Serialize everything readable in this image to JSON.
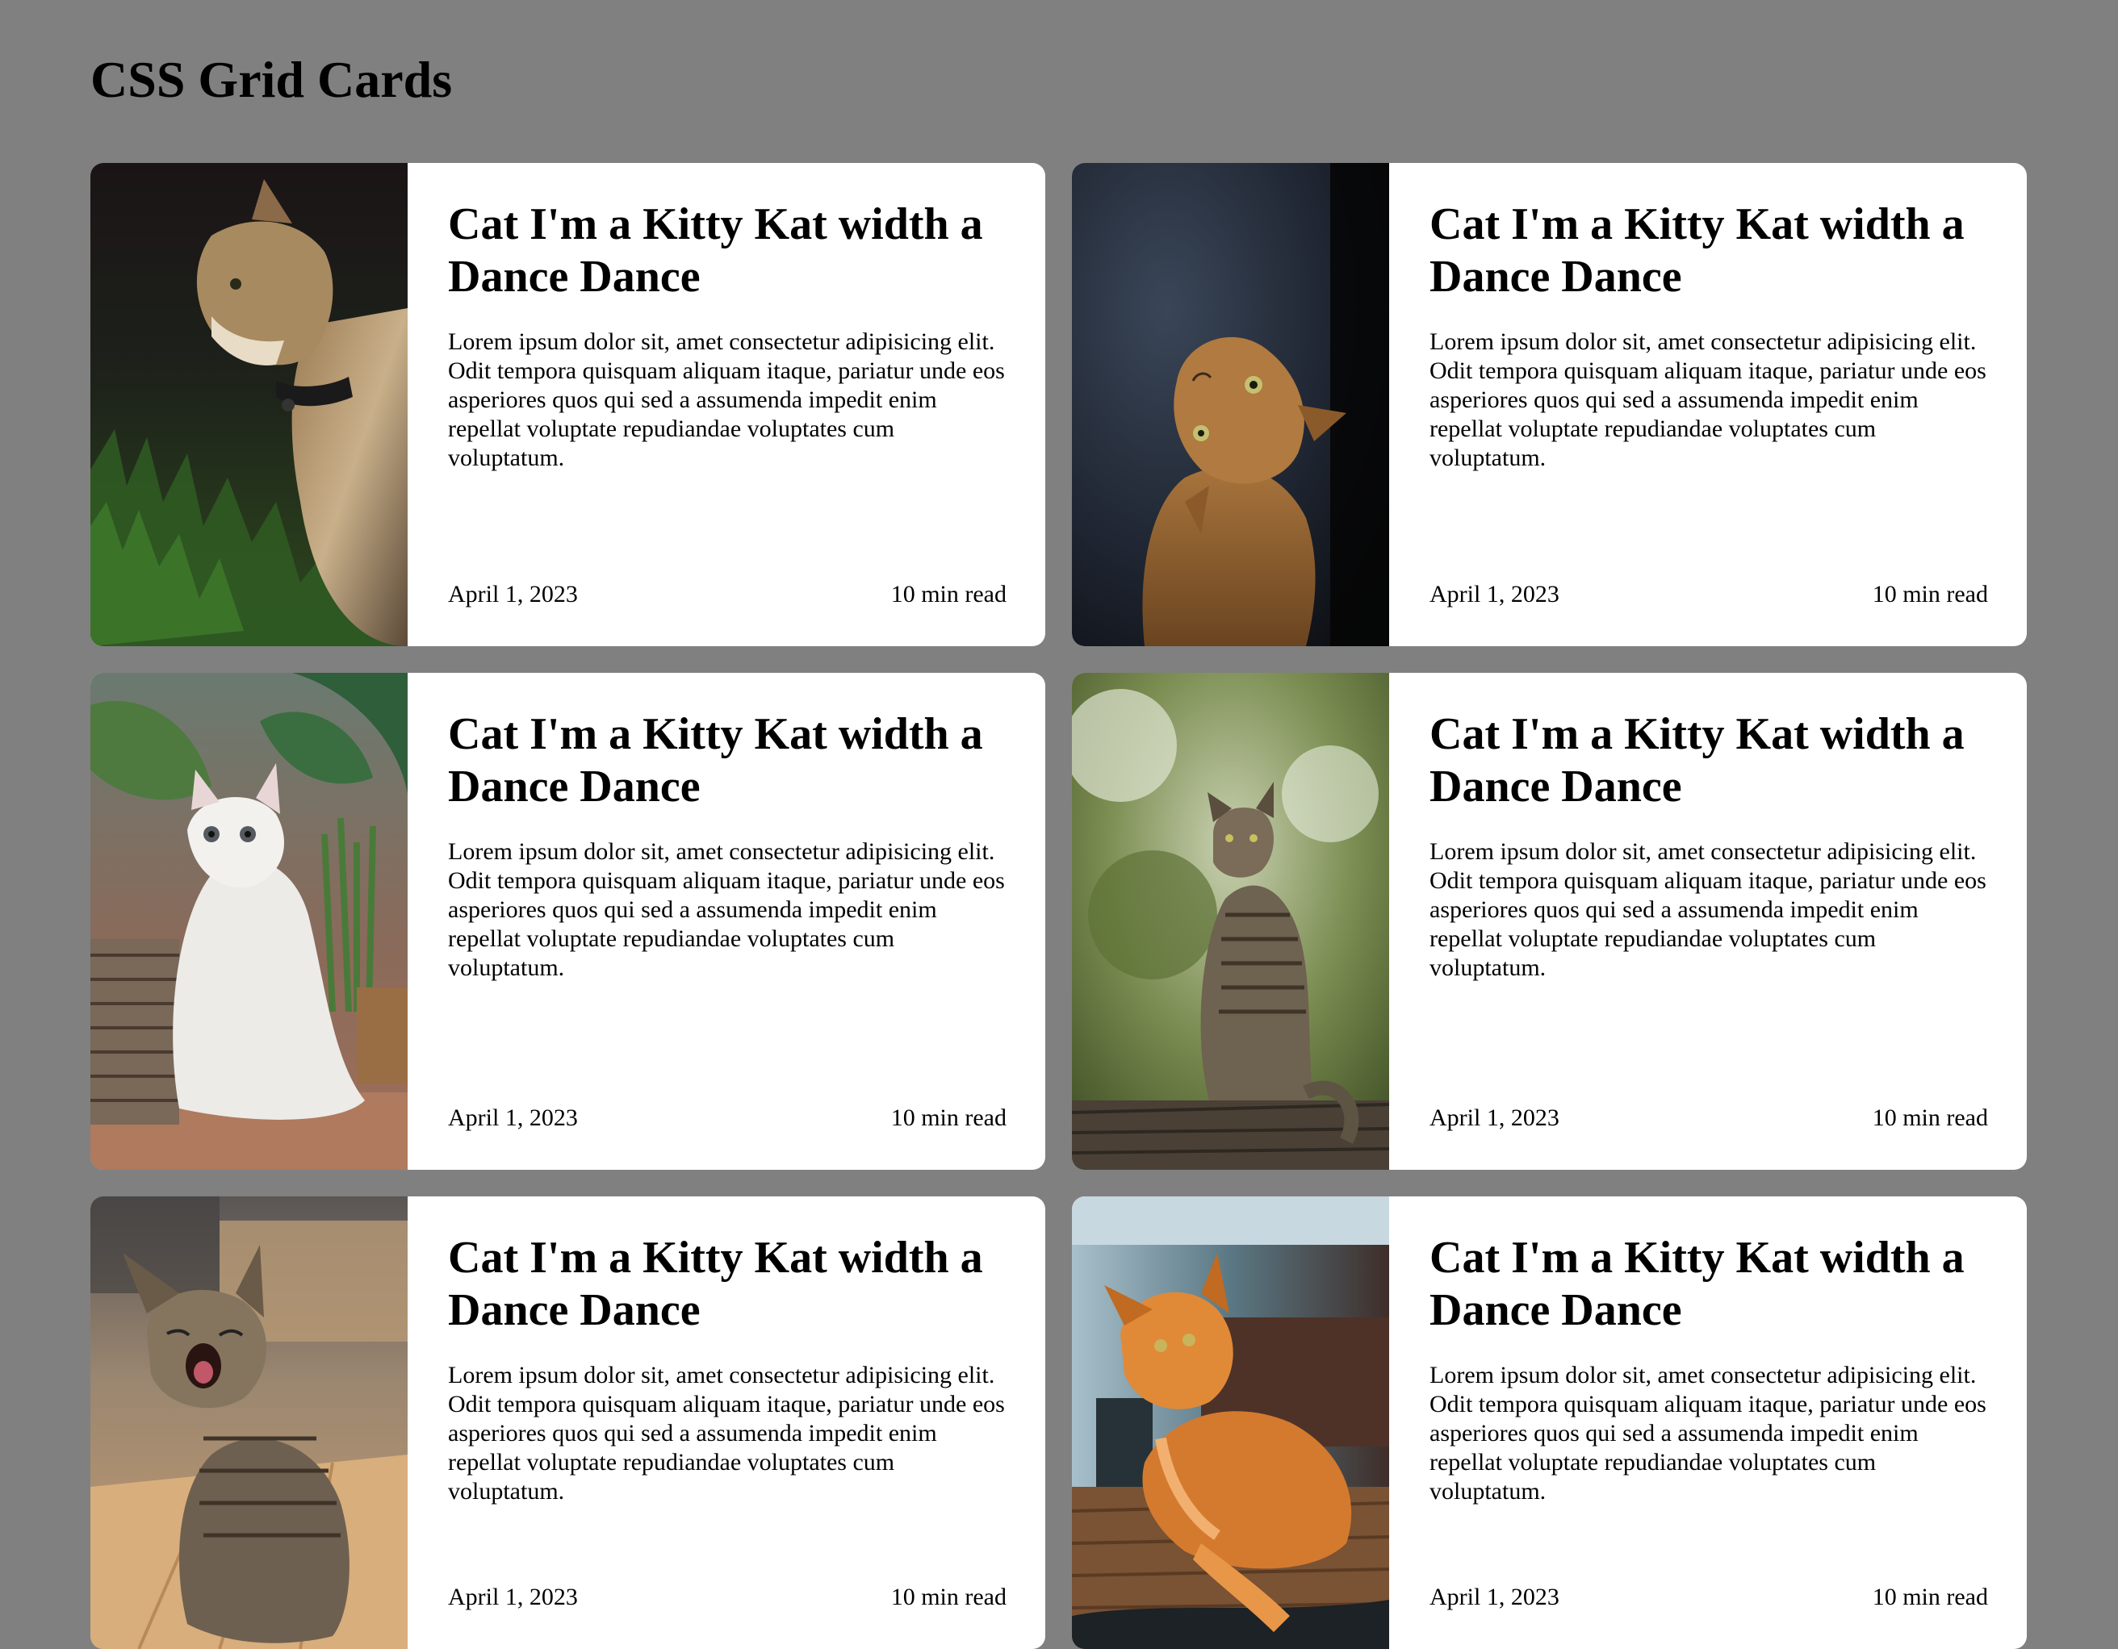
{
  "page": {
    "title": "CSS Grid Cards",
    "background": "#808080"
  },
  "cards": [
    {
      "image": "cat-photo-calico-grass",
      "title": "Cat I'm a Kitty Kat width a Dance Dance",
      "text": "Lorem ipsum dolor sit, amet consectetur adipisicing elit. Odit tempora quisquam aliquam itaque, pariatur unde eos asperiores quos qui sed a assumenda impedit enim repellat voluptate repudiandae voluptates cum voluptatum.",
      "date": "April 1, 2023",
      "read_time": "10 min read"
    },
    {
      "image": "cat-photo-orange-looking-up",
      "title": "Cat I'm a Kitty Kat width a Dance Dance",
      "text": "Lorem ipsum dolor sit, amet consectetur adipisicing elit. Odit tempora quisquam aliquam itaque, pariatur unde eos asperiores quos qui sed a assumenda impedit enim repellat voluptate repudiandae voluptates cum voluptatum.",
      "date": "April 1, 2023",
      "read_time": "10 min read"
    },
    {
      "image": "cat-photo-white-fluffy-plants",
      "title": "Cat I'm a Kitty Kat width a Dance Dance",
      "text": "Lorem ipsum dolor sit, amet consectetur adipisicing elit. Odit tempora quisquam aliquam itaque, pariatur unde eos asperiores quos qui sed a assumenda impedit enim repellat voluptate repudiandae voluptates cum voluptatum.",
      "date": "April 1, 2023",
      "read_time": "10 min read"
    },
    {
      "image": "cat-photo-tabby-on-fence",
      "title": "Cat I'm a Kitty Kat width a Dance Dance",
      "text": "Lorem ipsum dolor sit, amet consectetur adipisicing elit. Odit tempora quisquam aliquam itaque, pariatur unde eos asperiores quos qui sed a assumenda impedit enim repellat voluptate repudiandae voluptates cum voluptatum.",
      "date": "April 1, 2023",
      "read_time": "10 min read"
    },
    {
      "image": "cat-photo-kitten-yawning",
      "title": "Cat I'm a Kitty Kat width a Dance Dance",
      "text": "Lorem ipsum dolor sit, amet consectetur adipisicing elit. Odit tempora quisquam aliquam itaque, pariatur unde eos asperiores quos qui sed a assumenda impedit enim repellat voluptate repudiandae voluptates cum voluptatum.",
      "date": "April 1, 2023",
      "read_time": "10 min read"
    },
    {
      "image": "cat-photo-ginger-lying-table",
      "title": "Cat I'm a Kitty Kat width a Dance Dance",
      "text": "Lorem ipsum dolor sit, amet consectetur adipisicing elit. Odit tempora quisquam aliquam itaque, pariatur unde eos asperiores quos qui sed a assumenda impedit enim repellat voluptate repudiandae voluptates cum voluptatum.",
      "date": "April 1, 2023",
      "read_time": "10 min read"
    }
  ]
}
